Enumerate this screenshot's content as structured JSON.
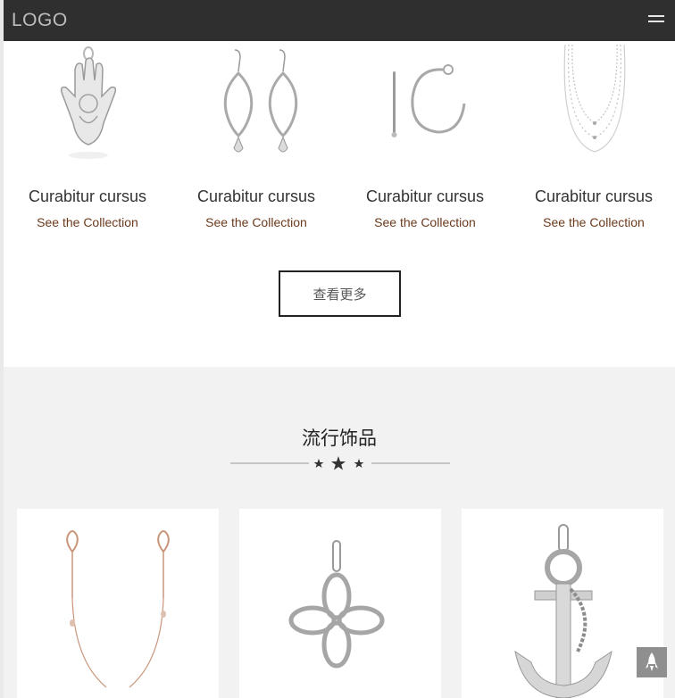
{
  "header": {
    "logo": "LOGO",
    "menu_icon": "hamburger-menu-icon"
  },
  "collection": {
    "items": [
      {
        "name": "Curabitur cursus",
        "link": "See the Collection",
        "image": "hamsa-pendant"
      },
      {
        "name": "Curabitur cursus",
        "link": "See the Collection",
        "image": "teardrop-earrings"
      },
      {
        "name": "Curabitur cursus",
        "link": "See the Collection",
        "image": "hoop-earring"
      },
      {
        "name": "Curabitur cursus",
        "link": "See the Collection",
        "image": "layered-necklace"
      }
    ],
    "more_button": "查看更多"
  },
  "popular": {
    "title": "流行饰品",
    "divider_icon": "three-stars-icon",
    "cards": [
      {
        "image": "rose-gold-hamsa-necklace"
      },
      {
        "image": "infinity-knot-pendant"
      },
      {
        "image": "anchor-pendant"
      }
    ]
  },
  "back_to_top_icon": "rocket-icon",
  "colors": {
    "header": "#2f2f2f",
    "link": "#6b3a1d",
    "section_bg": "#f2f2f2"
  }
}
